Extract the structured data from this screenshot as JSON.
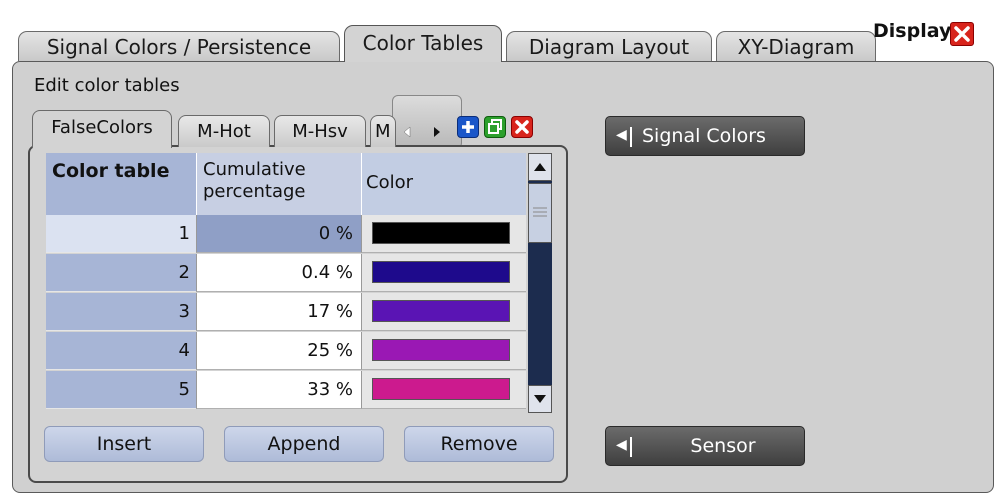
{
  "top_tabs": [
    {
      "label": "Signal Colors / Persistence",
      "active": false
    },
    {
      "label": "Color Tables",
      "active": true
    },
    {
      "label": "Diagram Layout",
      "active": false
    },
    {
      "label": "XY-Diagram",
      "active": false
    }
  ],
  "dialog_title": "Display",
  "section_label": "Edit color tables",
  "color_tabs": [
    {
      "label": "FalseColors",
      "active": true
    },
    {
      "label": "M-Hot",
      "active": false
    },
    {
      "label": "M-Hsv",
      "active": false
    },
    {
      "label": "M",
      "active": false
    }
  ],
  "table": {
    "headers": {
      "index": "Color table",
      "cumulative": "Cumulative percentage",
      "color": "Color"
    },
    "rows": [
      {
        "index": "1",
        "cumulative": "0 %",
        "color": "#000000"
      },
      {
        "index": "2",
        "cumulative": "0.4 %",
        "color": "#1e0a8c"
      },
      {
        "index": "3",
        "cumulative": "17 %",
        "color": "#5a14b4"
      },
      {
        "index": "4",
        "cumulative": "25 %",
        "color": "#9a18b4"
      },
      {
        "index": "5",
        "cumulative": "33 %",
        "color": "#cc1a8e"
      }
    ]
  },
  "buttons": {
    "insert": "Insert",
    "append": "Append",
    "remove": "Remove"
  },
  "side_buttons": {
    "signal_colors": "Signal Colors",
    "sensor": "Sensor"
  },
  "icons": {
    "close": "close-icon",
    "scroll_left": "arrow-left-icon",
    "scroll_right": "arrow-right-icon",
    "add": "plus-icon",
    "copy": "copy-icon",
    "delete": "delete-icon"
  },
  "colors": {
    "accent_blue": "#a7b5d6",
    "close_red": "#d8241c",
    "side_button": "#4f4f4f"
  }
}
